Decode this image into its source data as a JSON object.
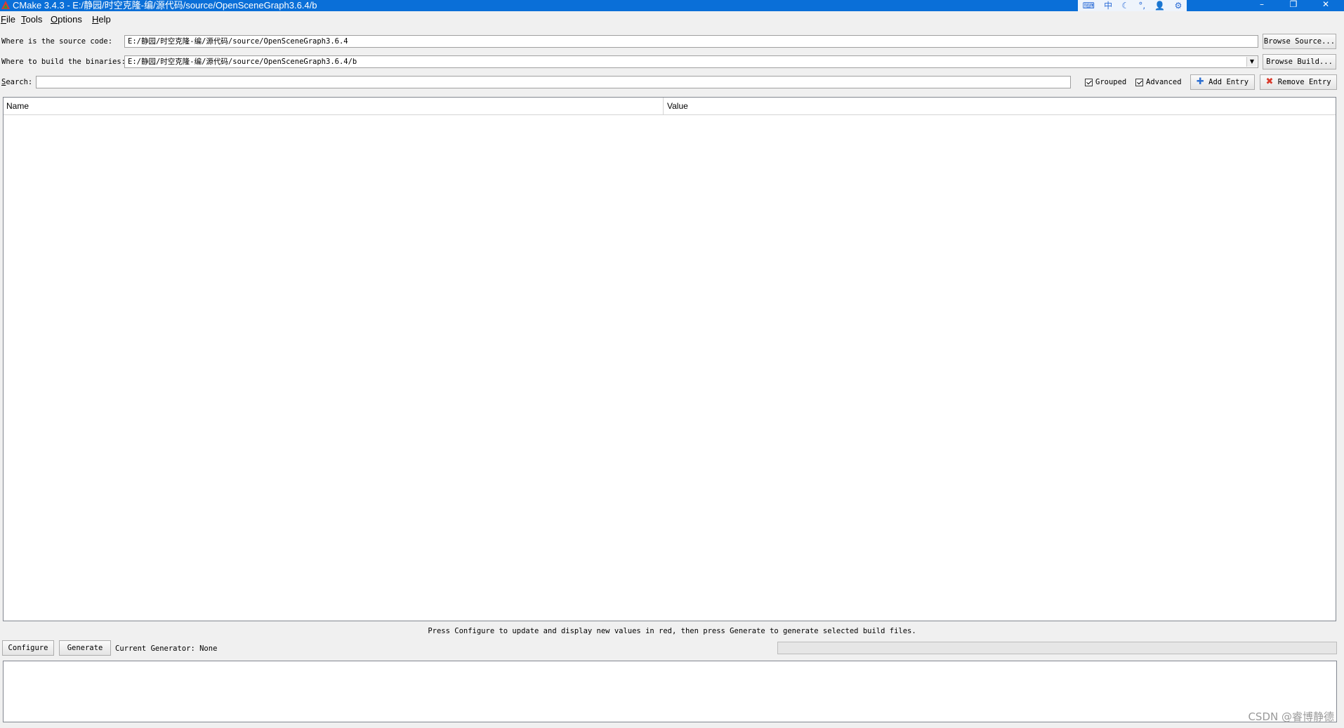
{
  "window": {
    "title": "CMake 3.4.3 - E:/静园/时空克隆-编/源代码/source/OpenSceneGraph3.6.4/b",
    "controls": {
      "minimize": "–",
      "restore": "❐",
      "close": "✕"
    }
  },
  "ime_toolbar": {
    "icons": [
      "input-method-icon",
      "chinese-mode-icon",
      "moon-icon",
      "punctuation-icon",
      "user-icon",
      "gear-icon"
    ],
    "chinese_label": "中"
  },
  "menu": [
    {
      "label": "File",
      "underline": "F"
    },
    {
      "label": "Tools",
      "underline": "T"
    },
    {
      "label": "Options",
      "underline": "O"
    },
    {
      "label": "Help",
      "underline": "H"
    }
  ],
  "source": {
    "label": "Where is the source code:",
    "value": "E:/静园/时空克隆-编/源代码/source/OpenSceneGraph3.6.4",
    "browse_label": "Browse Source..."
  },
  "build": {
    "label": "Where to build the binaries:",
    "value": "E:/静园/时空克隆-编/源代码/source/OpenSceneGraph3.6.4/b",
    "browse_label": "Browse Build..."
  },
  "search": {
    "label_first": "S",
    "label_rest": "earch:",
    "value": ""
  },
  "options": {
    "grouped": {
      "label": "Grouped",
      "checked": true
    },
    "advanced": {
      "label": "Advanced",
      "checked": true
    }
  },
  "add_entry_label": "Add Entry",
  "remove_entry_label": "Remove Entry",
  "table": {
    "columns": [
      "Name",
      "Value"
    ],
    "rows": []
  },
  "status_message": "Press Configure to update and display new values in red, then press Generate to generate selected build files.",
  "configure_label": "Configure",
  "generate_label": "Generate",
  "current_generator": "Current Generator: None",
  "progress": 0,
  "output_text": "",
  "watermark": "CSDN @睿博静德",
  "colors": {
    "titlebar": "#0a6fd8",
    "add_icon": "#2d6fd1",
    "remove_icon": "#d93a2b"
  }
}
